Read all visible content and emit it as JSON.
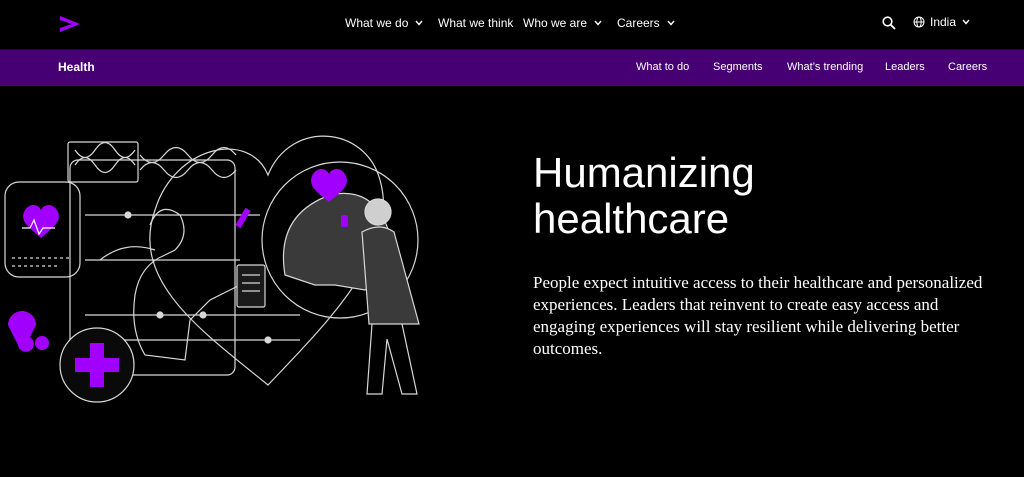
{
  "brand": {
    "logo_icon": "accenture-chevron-icon",
    "accent": "#a100ff"
  },
  "topnav": {
    "items": [
      {
        "label": "What we do",
        "has_dropdown": true
      },
      {
        "label": "What we think",
        "has_dropdown": false
      },
      {
        "label": "Who we are",
        "has_dropdown": true
      },
      {
        "label": "Careers",
        "has_dropdown": true
      }
    ],
    "search_icon": "search-icon",
    "country_label": "India",
    "globe_icon": "globe-icon"
  },
  "subnav": {
    "title": "Health",
    "background": "#460073",
    "links": [
      "What to do",
      "Segments",
      "What’s trending",
      "Leaders",
      "Careers"
    ]
  },
  "hero": {
    "title": "Humanizing healthcare",
    "body": "People expect intuitive access to their healthcare and personalized experiences. Leaders that reinvent to create easy access and engaging experiences will stay resilient while delivering better outcomes."
  }
}
